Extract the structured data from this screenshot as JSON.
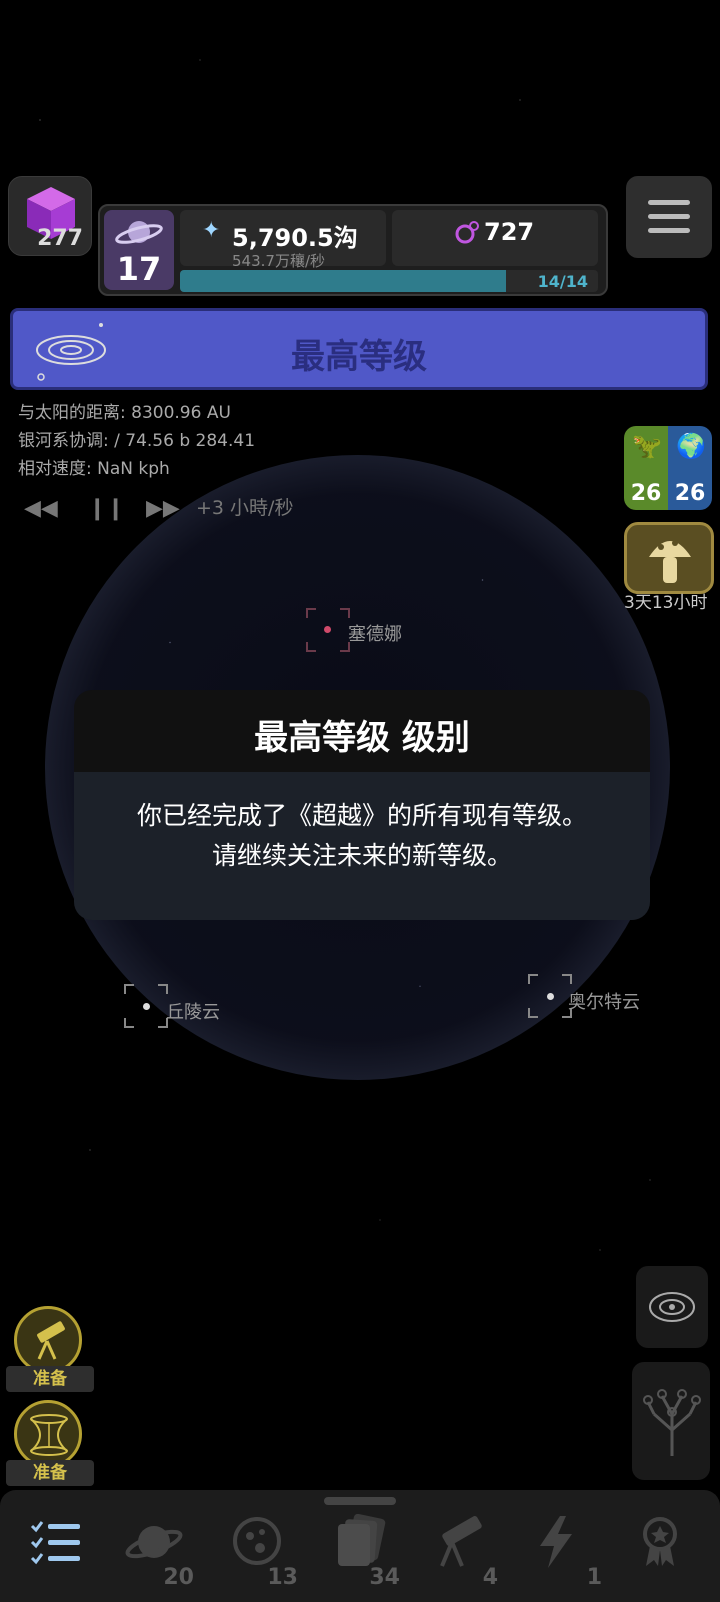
{
  "header": {
    "cube_count": "277",
    "level": "17",
    "resource_main": "5,790.5沟",
    "resource_rate": "543.7万穰/秒",
    "resource_secondary": "727",
    "progress_label": "14/14",
    "progress_fraction": 0.78
  },
  "banner": {
    "title": "最高等级"
  },
  "info": {
    "distance": "与太阳的距离: 8300.96 AU",
    "galactic": "银河系协调: / 74.56 b 284.41",
    "velocity": "相对速度: NaN kph"
  },
  "time_control": {
    "speed_label": "+3 小時/秒"
  },
  "badges": {
    "dino_count": "26",
    "earth_count": "26",
    "mushroom_timer": "3天13小时"
  },
  "markers": {
    "sedna": "塞德娜",
    "hills": "丘陵云",
    "oort": "奥尔特云"
  },
  "modal": {
    "title": "最高等级 级别",
    "line1": "你已经完成了《超越》的所有现有等级。",
    "line2": "请继续关注未来的新等级。"
  },
  "left_buttons": {
    "telescope_ready": "准备",
    "wormhole_ready": "准备"
  },
  "nav": {
    "planets_count": "20",
    "moons_count": "13",
    "cards_count": "34",
    "telescope_count": "4",
    "energy_count": "1"
  },
  "colors": {
    "banner": "#5058c8",
    "progress": "#2f7c8c",
    "ready_gold": "#d4c04c"
  }
}
